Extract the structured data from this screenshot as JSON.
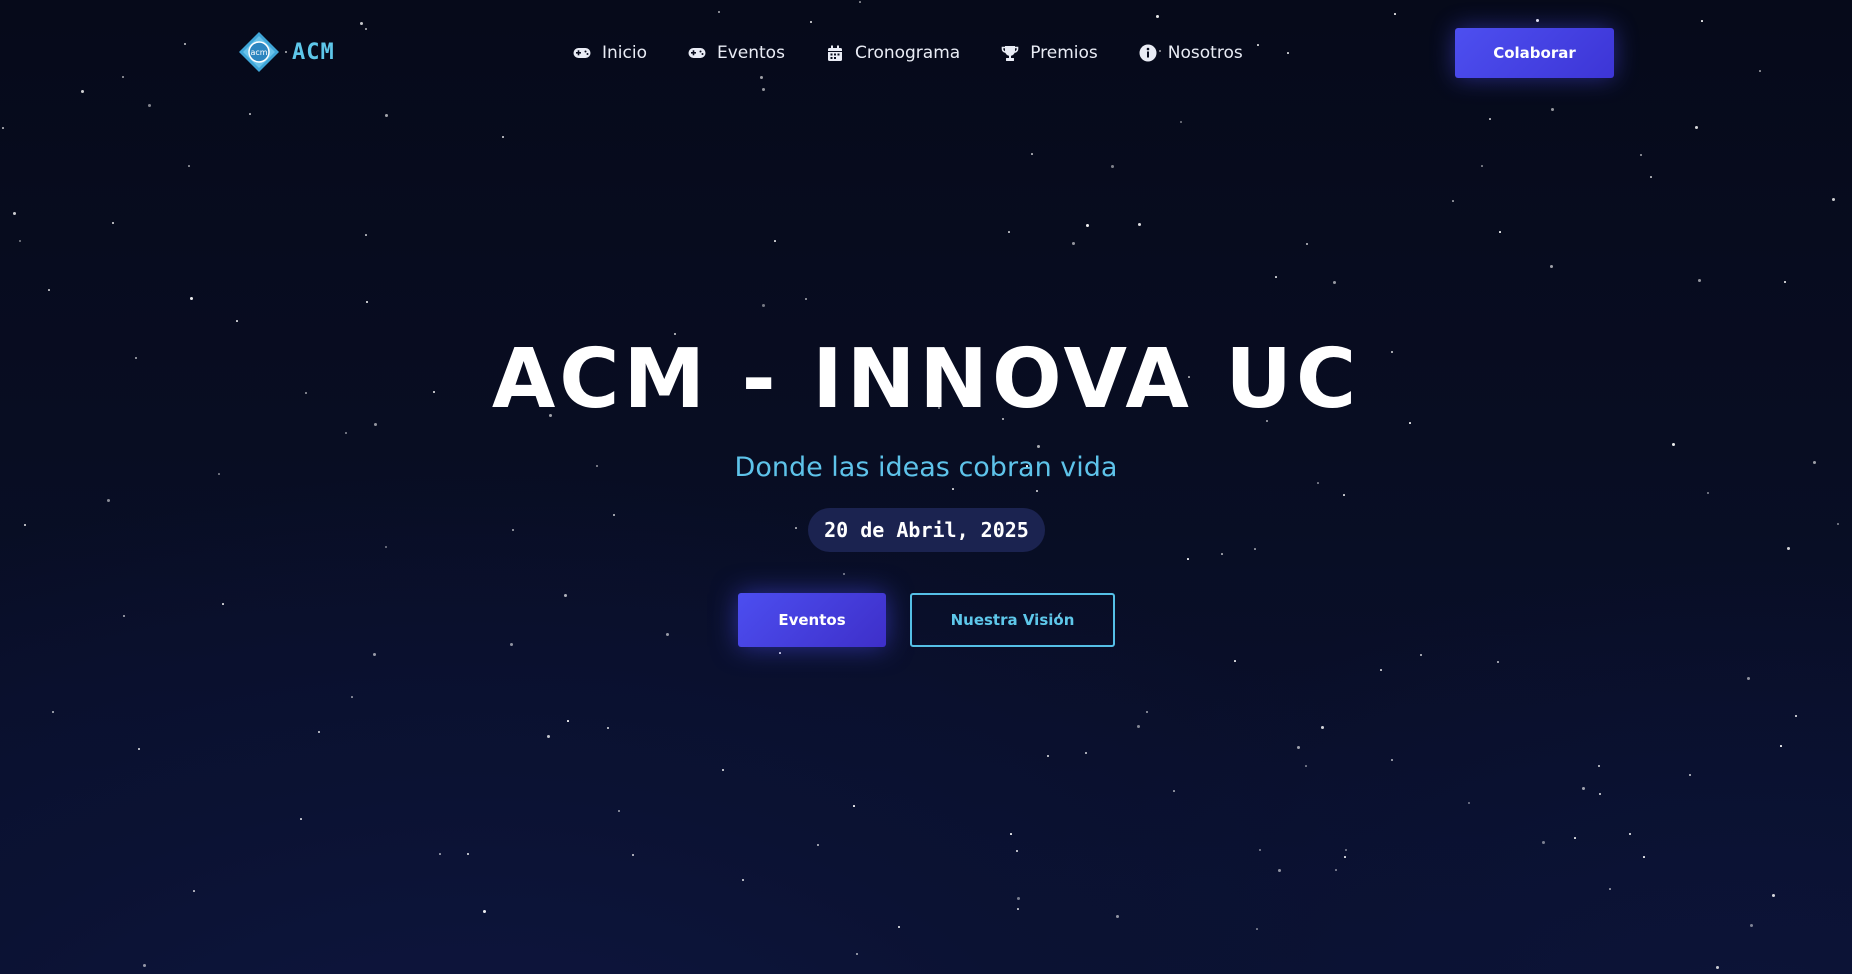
{
  "brand": {
    "name": "ACM",
    "logo_text": "acm"
  },
  "nav": {
    "items": [
      {
        "label": "Inicio",
        "icon": "gamepad-icon"
      },
      {
        "label": "Eventos",
        "icon": "gamepad-icon"
      },
      {
        "label": "Cronograma",
        "icon": "calendar-icon"
      },
      {
        "label": "Premios",
        "icon": "trophy-icon"
      },
      {
        "label": "Nosotros",
        "icon": "info-icon"
      }
    ]
  },
  "header": {
    "cta_label": "Colaborar"
  },
  "hero": {
    "title": "ACM - INNOVA UC",
    "subtitle": "Donde las ideas cobran vida",
    "date": "20 de Abril, 2025",
    "primary_button": "Eventos",
    "secondary_button": "Nuestra Visión"
  },
  "colors": {
    "background": "#070b1d",
    "accent": "#5ec7ea",
    "button_primary": "#4d4ff0",
    "date_pill": "#1b2350"
  }
}
